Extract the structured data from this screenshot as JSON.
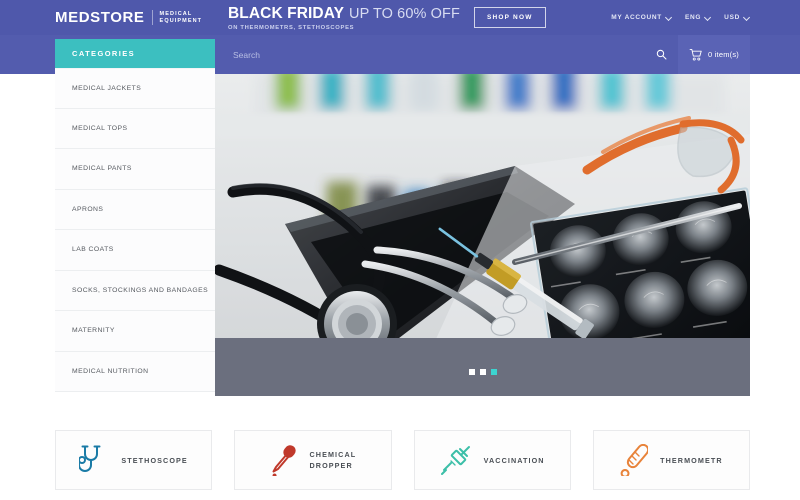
{
  "brand": {
    "name": "MEDSTORE",
    "tagline_line1": "MEDICAL",
    "tagline_line2": "EQUIPMENT"
  },
  "promo": {
    "headline_bold": "BLACK FRIDAY",
    "headline_light": "UP TO 60% OFF",
    "subtitle": "ON THERMOMETRS, STETHOSCOPES",
    "cta_label": "SHOP NOW"
  },
  "top_nav": {
    "account_label": "MY ACCOUNT",
    "language_label": "ENG",
    "currency_label": "USD"
  },
  "search": {
    "placeholder": "Search",
    "value": ""
  },
  "cart": {
    "count_label": "0 item(s)"
  },
  "sidebar": {
    "header": "CATEGORIES",
    "items": [
      {
        "label": "MEDICAL JACKETS"
      },
      {
        "label": "MEDICAL TOPS"
      },
      {
        "label": "MEDICAL PANTS"
      },
      {
        "label": "APRONS"
      },
      {
        "label": "LAB COATS"
      },
      {
        "label": "SOCKS, STOCKINGS AND BANDAGES"
      },
      {
        "label": "MATERNITY"
      },
      {
        "label": "MEDICAL NUTRITION"
      }
    ]
  },
  "hero": {
    "slide_count": 3,
    "active_slide": 3
  },
  "features": [
    {
      "label": "STETHOSCOPE",
      "icon": "stethoscope-icon",
      "color": "#1a7ba6"
    },
    {
      "label_line1": "CHEMICAL",
      "label_line2": "DROPPER",
      "icon": "chemical-dropper-icon",
      "color": "#c0392b"
    },
    {
      "label": "VACCINATION",
      "icon": "syringe-icon",
      "color": "#3cbfa8"
    },
    {
      "label": "THERMOMETR",
      "icon": "thermometer-icon",
      "color": "#e8833a"
    }
  ],
  "colors": {
    "header_purple": "#4f58ab",
    "search_purple": "#535cae",
    "teal": "#3cbfc0",
    "hero_band_gray": "#6b6f7e"
  }
}
